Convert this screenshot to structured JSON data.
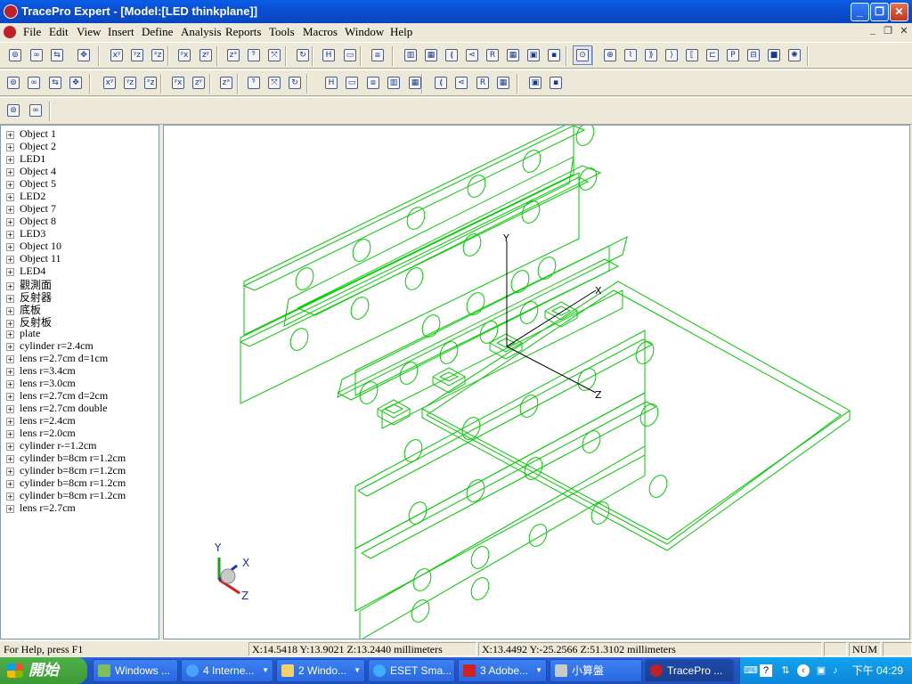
{
  "window": {
    "title": "TracePro Expert - [Model:[LED thinkplane]]"
  },
  "menu": [
    "File",
    "Edit",
    "View",
    "Insert",
    "Define",
    "Analysis",
    "Reports",
    "Tools",
    "Macros",
    "Window",
    "Help"
  ],
  "tree": {
    "items": [
      "Object 1",
      "Object 2",
      "LED1",
      "Object 4",
      "Object 5",
      "LED2",
      "Object 7",
      "Object 8",
      "LED3",
      "Object 10",
      "Object 11",
      "LED4",
      "觀測面",
      "反射器",
      "底板",
      "反射板",
      "plate",
      "cylinder r=2.4cm",
      "lens r=2.7cm d=1cm",
      "lens r=3.4cm",
      "lens r=3.0cm",
      "lens r=2.7cm d=2cm",
      "lens r=2.7cm double",
      "lens r=2.4cm",
      "lens r=2.0cm",
      "cylinder r-=1.2cm",
      "cylinder b=8cm r=1.2cm",
      "cylinder b=8cm r=1.2cm",
      "cylinder b=8cm r=1.2cm",
      "cylinder b=8cm r=1.2cm",
      "lens r=2.7cm"
    ],
    "expander": "+"
  },
  "viewport": {
    "axis_labels": {
      "y": "Y",
      "x": "X",
      "z": "Z"
    },
    "triad_labels": {
      "y": "Y",
      "x": "X",
      "z": "Z"
    },
    "model_color": "#00cc00"
  },
  "status": {
    "help": "For Help, press F1",
    "coords1": "X:14.5418 Y:13.9021 Z:13.2440 millimeters",
    "coords2": "X:13.4492 Y:-25.2566 Z:51.3102 millimeters",
    "num": "NUM"
  },
  "taskbar": {
    "start": "開始",
    "tasks": [
      "Windows ...",
      "4 Interne...",
      "2 Windo...",
      "ESET Sma...",
      "3 Adobe...",
      "小算盤",
      "TracePro ..."
    ],
    "clock": "下午 04:29"
  },
  "toolbar_icons": {
    "row1": [
      "new-icon",
      "open-icon",
      "save-icon",
      "print-icon",
      "cut-icon",
      "copy-icon",
      "paste-icon",
      "undo-icon",
      "redo-icon",
      "boolean-icon",
      "boolean2-icon",
      "boolean3-icon",
      "edit-icon",
      "select-icon",
      "select2-icon",
      "properties-icon",
      "zoom-in-icon",
      "zoom-out-icon",
      "zoom-window-icon",
      "zoom-all-icon",
      "zoom-prev-icon",
      "zoom-sel-icon",
      "view-a-icon",
      "view-b-icon",
      "pan-icon",
      "view-xy-icon",
      "view-yz-icon",
      "view-xz-icon",
      "view-yx-icon",
      "view-zy-icon",
      "view-zx-icon",
      "view-iso-icon",
      "view-iso2-icon",
      "rotate-icon",
      "home-icon"
    ],
    "row2": [
      "window1-icon",
      "window2-icon",
      "window3-icon",
      "window4-icon",
      "trace-icon",
      "trace2-icon",
      "rev-icon",
      "grid-icon",
      "image-icon",
      "source-icon",
      "grid-source-icon",
      "target-icon",
      "chart-icon",
      "lens-icon",
      "bracket-icon",
      "prism-icon",
      "c-icon",
      "p-icon",
      "block-icon",
      "cube-icon",
      "surface-icon",
      "cone-icon",
      "help-icon",
      "whats-this-icon"
    ],
    "row3": [
      "check-icon",
      "ruler-icon"
    ]
  }
}
